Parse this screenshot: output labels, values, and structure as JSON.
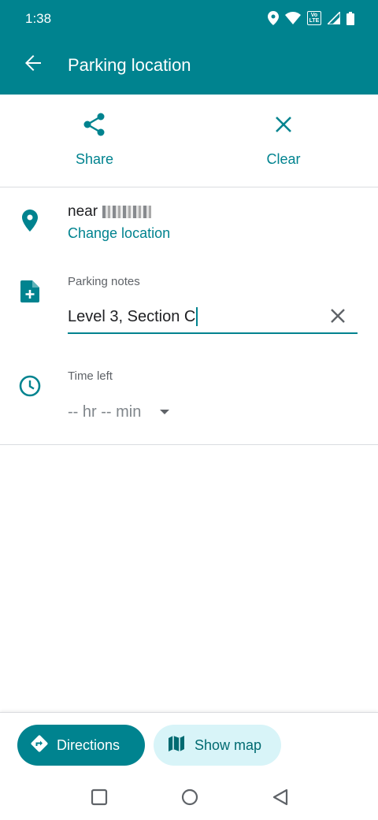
{
  "status": {
    "time": "1:38",
    "network_badge": "Vo LTE",
    "icons": [
      "location-icon",
      "wifi-icon",
      "volte-badge",
      "signal-icon",
      "battery-icon"
    ]
  },
  "appbar": {
    "title": "Parking location",
    "back_icon": "back-arrow-icon"
  },
  "actions": {
    "share_label": "Share",
    "clear_label": "Clear"
  },
  "location": {
    "prefix": "near",
    "change_label": "Change location"
  },
  "notes": {
    "label": "Parking notes",
    "value": "Level 3, Section C"
  },
  "time_left": {
    "label": "Time left",
    "value": "-- hr -- min"
  },
  "bottom": {
    "directions_label": "Directions",
    "show_map_label": "Show map"
  },
  "colors": {
    "primary": "#00838f",
    "chip_bg": "#d8f4f8",
    "divider": "#dadce0"
  }
}
